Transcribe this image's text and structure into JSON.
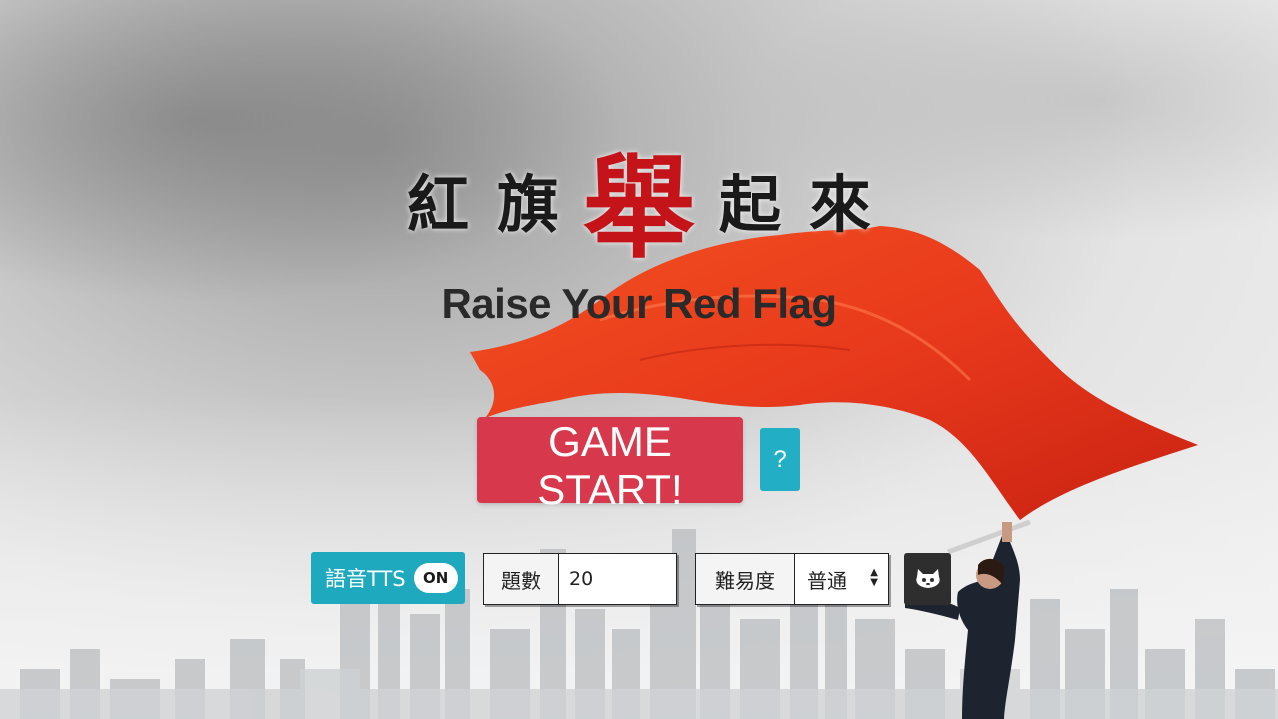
{
  "title": {
    "cn_chars": [
      "紅",
      "旗",
      "舉",
      "起",
      "來"
    ],
    "en": "Raise Your Red Flag"
  },
  "buttons": {
    "start_label": "GAME START!",
    "help_label": "?"
  },
  "controls": {
    "tts_label": "語音TTS",
    "tts_state": "ON",
    "question_count_label": "題數",
    "question_count_value": "20",
    "difficulty_label": "難易度",
    "difficulty_value": "普通"
  },
  "icons": {
    "github": "github-octocat-icon"
  },
  "colors": {
    "accent_red": "#d7384b",
    "accent_teal": "#1ea9bf",
    "flag_red": "#e8391c",
    "title_red": "#c4141a"
  }
}
